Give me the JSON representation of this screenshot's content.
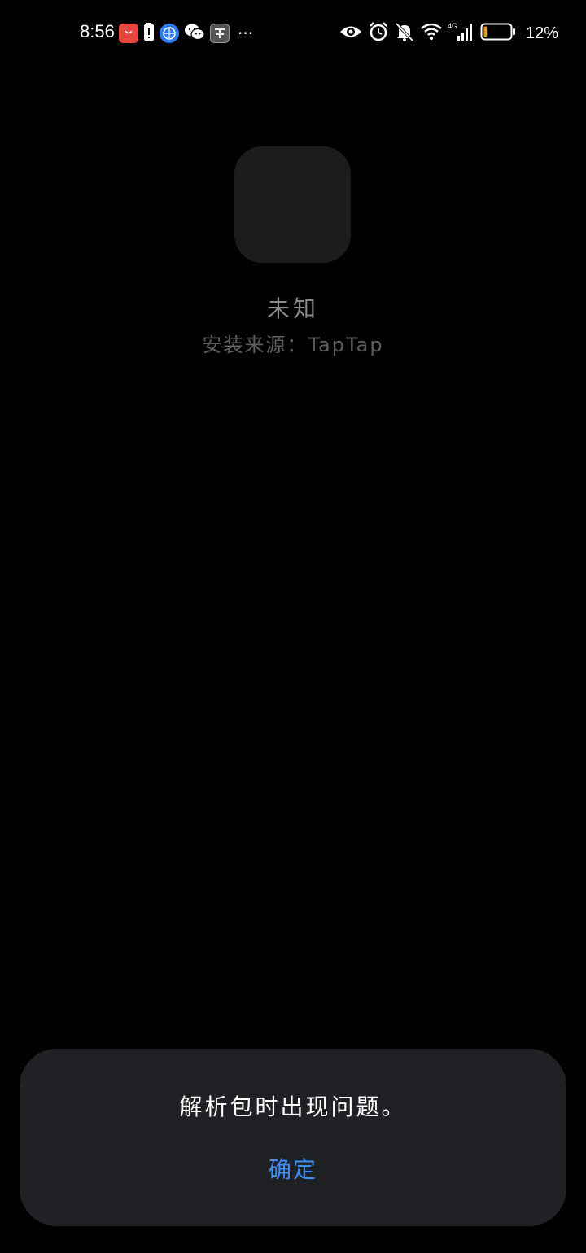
{
  "status_bar": {
    "time": "8:56",
    "battery_percent": "12%",
    "battery_level": 0.12,
    "network_type": "4G",
    "overflow_indicator": "···",
    "notification_icons": [
      "huawei-appgallery-icon",
      "battery-alert-icon",
      "browser-icon",
      "wechat-icon",
      "game-app-icon"
    ],
    "system_icons": [
      "eye-comfort-icon",
      "alarm-icon",
      "mute-icon",
      "wifi-icon",
      "cellular-signal-icon",
      "battery-icon"
    ]
  },
  "app_info": {
    "name": "未知",
    "install_source": "安装来源：TapTap"
  },
  "dialog": {
    "message": "解析包时出现问题。",
    "confirm_label": "确定"
  },
  "colors": {
    "background": "#000000",
    "dialog_background": "#202124",
    "accent": "#3f8ef7",
    "battery_low": "#f39c12"
  }
}
